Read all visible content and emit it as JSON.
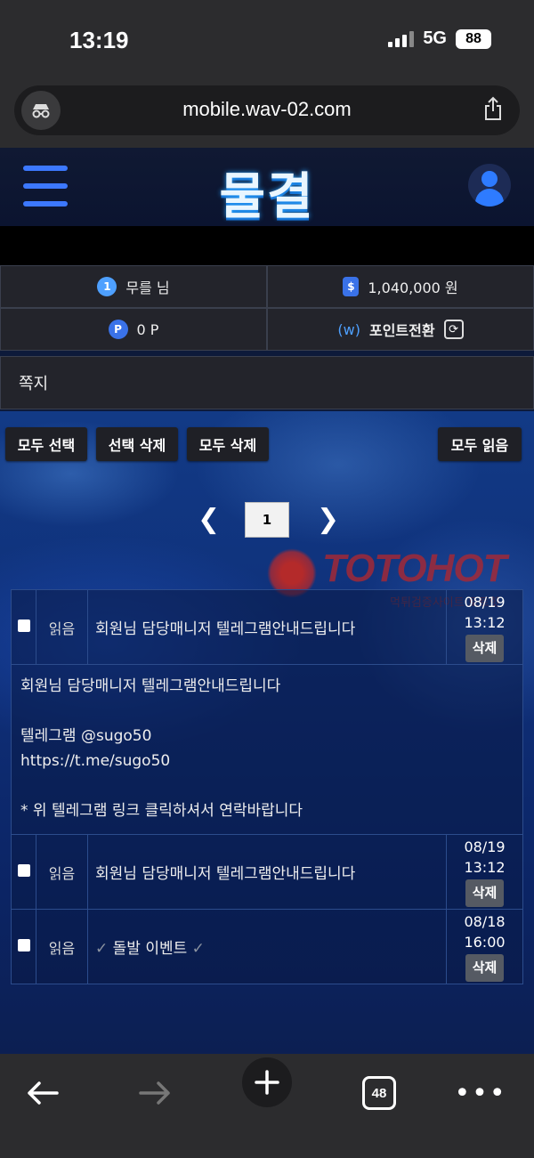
{
  "status_bar": {
    "time": "13:19",
    "network": "5G",
    "battery": "88"
  },
  "browser": {
    "url": "mobile.wav-02.com",
    "tab_count": "48"
  },
  "site": {
    "logo_text": "물결"
  },
  "user_info": {
    "username": "무를 님",
    "balance": "1,040,000 원",
    "points": "0 P",
    "convert_label": "포인트전환"
  },
  "section": {
    "title": "쪽지"
  },
  "actions": {
    "select_all": "모두 선택",
    "delete_selected": "선택 삭제",
    "delete_all": "모두 삭제",
    "read_all": "모두 읽음"
  },
  "pagination": {
    "current_page": "1"
  },
  "watermark": {
    "brand": "TOTOHOT",
    "sub": "먹튀검증사이트 토토핫"
  },
  "messages": [
    {
      "status": "읽음",
      "title": "회원님 담당매니저 텔레그램안내드립니다",
      "date": "08/19",
      "time": "13:12",
      "delete_label": "삭제",
      "expanded": true,
      "content_lines": [
        "회원님 담당매니저 텔레그램안내드립니다",
        "",
        "텔레그램 @sugo50",
        "https://t.me/sugo50",
        "",
        "* 위 텔레그램 링크 클릭하셔서 연락바랍니다"
      ]
    },
    {
      "status": "읽음",
      "title": "회원님 담당매니저 텔레그램안내드립니다",
      "date": "08/19",
      "time": "13:12",
      "delete_label": "삭제"
    },
    {
      "status": "읽음",
      "title_prefix": "✓",
      "title": "돌발 이벤트",
      "title_suffix": "✓",
      "date": "08/18",
      "time": "16:00",
      "delete_label": "삭제"
    }
  ],
  "icons": {
    "privacy": "incognito-icon",
    "share": "share-icon",
    "menu": "hamburger-icon",
    "profile": "user-icon",
    "back": "back-arrow-icon",
    "forward": "forward-arrow-icon",
    "new_tab": "plus-icon",
    "more": "more-icon"
  }
}
